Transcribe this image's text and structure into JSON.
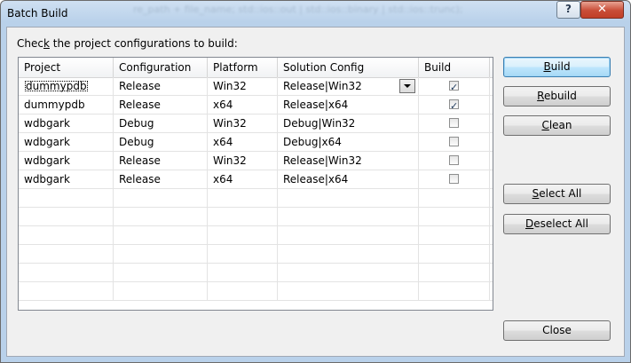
{
  "window": {
    "title": "Batch Build",
    "help_label": "?",
    "close_label": "✕"
  },
  "instruction": {
    "pre": "Chec",
    "accel": "k",
    "post": " the project configurations to build:"
  },
  "columns": [
    "Project",
    "Configuration",
    "Platform",
    "Solution Config",
    "Build"
  ],
  "rows": [
    {
      "project": "dummypdb",
      "configuration": "Release",
      "platform": "Win32",
      "solution_config": "Release|Win32",
      "build": true
    },
    {
      "project": "dummypdb",
      "configuration": "Release",
      "platform": "x64",
      "solution_config": "Release|x64",
      "build": true
    },
    {
      "project": "wdbgark",
      "configuration": "Debug",
      "platform": "Win32",
      "solution_config": "Debug|Win32",
      "build": false
    },
    {
      "project": "wdbgark",
      "configuration": "Debug",
      "platform": "x64",
      "solution_config": "Debug|x64",
      "build": false
    },
    {
      "project": "wdbgark",
      "configuration": "Release",
      "platform": "Win32",
      "solution_config": "Release|Win32",
      "build": false
    },
    {
      "project": "wdbgark",
      "configuration": "Release",
      "platform": "x64",
      "solution_config": "Release|x64",
      "build": false
    }
  ],
  "buttons": {
    "build": {
      "accel": "B",
      "rest": "uild"
    },
    "rebuild": {
      "accel": "R",
      "rest": "ebuild"
    },
    "clean": {
      "accel": "C",
      "rest": "lean"
    },
    "select_all": {
      "accel": "S",
      "rest": "elect All"
    },
    "deselect_all": {
      "accel": "D",
      "rest": "eselect All"
    },
    "close": "Close"
  }
}
